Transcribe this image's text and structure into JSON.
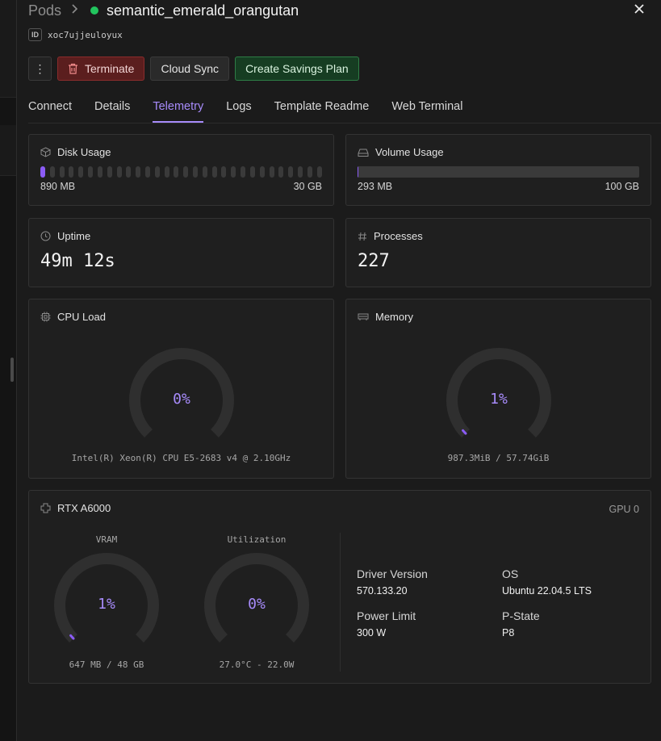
{
  "header": {
    "breadcrumb_root": "Pods",
    "pod_name": "semantic_emerald_orangutan",
    "status_color": "#22c55e"
  },
  "pod_id": {
    "badge": "ID",
    "value": "xoc7ujjeuloyux"
  },
  "actions": {
    "terminate": "Terminate",
    "cloud_sync": "Cloud Sync",
    "savings_plan": "Create Savings Plan"
  },
  "tabs": [
    {
      "label": "Connect"
    },
    {
      "label": "Details"
    },
    {
      "label": "Telemetry"
    },
    {
      "label": "Logs"
    },
    {
      "label": "Template Readme"
    },
    {
      "label": "Web Terminal"
    }
  ],
  "active_tab": "Telemetry",
  "disk": {
    "title": "Disk Usage",
    "used": "890 MB",
    "total": "30 GB",
    "segments": 30,
    "filled_segments": 1
  },
  "volume": {
    "title": "Volume Usage",
    "used": "293 MB",
    "total": "100 GB",
    "fill_fraction": 0.003
  },
  "uptime": {
    "title": "Uptime",
    "value": "49m 12s"
  },
  "processes": {
    "title": "Processes",
    "value": "227"
  },
  "cpu": {
    "title": "CPU Load",
    "percent_label": "0%",
    "percent": 0,
    "caption": "Intel(R) Xeon(R) CPU E5-2683 v4 @ 2.10GHz"
  },
  "memory": {
    "title": "Memory",
    "percent_label": "1%",
    "percent": 1,
    "caption": "987.3MiB / 57.74GiB"
  },
  "gpu": {
    "title": "RTX A6000",
    "index": "GPU 0",
    "vram": {
      "heading": "VRAM",
      "percent_label": "1%",
      "percent": 1,
      "caption": "647 MB / 48 GB"
    },
    "util": {
      "heading": "Utilization",
      "percent_label": "0%",
      "percent": 0,
      "caption": "27.0°C - 22.0W"
    },
    "specs": {
      "driver_label": "Driver Version",
      "driver_value": "570.133.20",
      "os_label": "OS",
      "os_value": "Ubuntu 22.04.5 LTS",
      "power_label": "Power Limit",
      "power_value": "300 W",
      "pstate_label": "P-State",
      "pstate_value": "P8"
    }
  },
  "colors": {
    "accent": "#a78bfa",
    "gauge_fill": "#8b5cf6",
    "track": "#2f2f2f"
  }
}
